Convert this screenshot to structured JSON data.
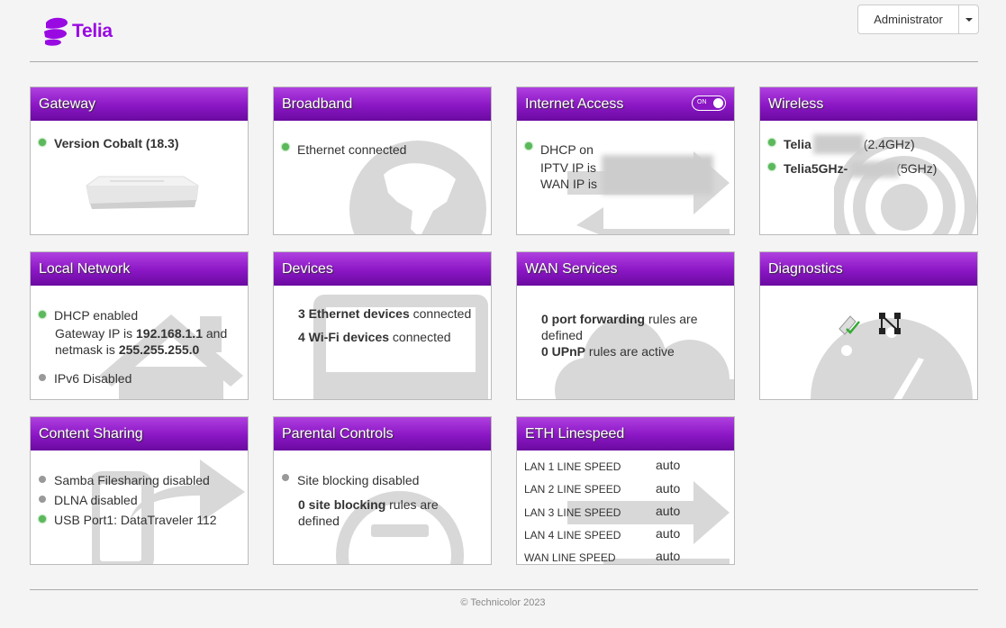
{
  "header": {
    "logo_text": "Telia",
    "user_menu_label": "Administrator"
  },
  "cards": {
    "gateway": {
      "title": "Gateway",
      "version": "Version Cobalt (18.3)"
    },
    "broadband": {
      "title": "Broadband",
      "status": "Ethernet connected"
    },
    "internet": {
      "title": "Internet Access",
      "toggle_label": "ON",
      "dhcp": "DHCP on",
      "iptv": "IPTV IP is",
      "wan": "WAN IP is"
    },
    "wireless": {
      "title": "Wireless",
      "ssid_24": "Telia",
      "band_24": "(2.4GHz)",
      "ssid_5": "Telia5GHz-",
      "band_5": "(5GHz)"
    },
    "local": {
      "title": "Local Network",
      "dhcp": "DHCP enabled",
      "gw_prefix": "Gateway IP is ",
      "gw_ip": "192.168.1.1",
      "gw_and": " and",
      "nm_prefix": "netmask is ",
      "netmask": "255.255.255.0",
      "ipv6": "IPv6 Disabled"
    },
    "devices": {
      "title": "Devices",
      "eth_count": "3 Ethernet devices",
      "eth_suffix": " connected",
      "wifi_count": "4 Wi-Fi devices",
      "wifi_suffix": " connected"
    },
    "wan_services": {
      "title": "WAN Services",
      "pf_count": "0 port forwarding",
      "pf_suffix": " rules are",
      "pf_suffix2": "defined",
      "upnp_count": "0 UPnP",
      "upnp_suffix": " rules are active"
    },
    "diagnostics": {
      "title": "Diagnostics"
    },
    "content": {
      "title": "Content Sharing",
      "samba": "Samba Filesharing disabled",
      "dlna": "DLNA disabled",
      "usb": "USB Port1: DataTraveler 112"
    },
    "parental": {
      "title": "Parental Controls",
      "site": "Site blocking disabled",
      "count": "0 site blocking",
      "suffix": " rules are",
      "suffix2": "defined"
    },
    "eth": {
      "title": "ETH Linespeed",
      "rows": [
        {
          "label": "LAN 1 LINE SPEED",
          "value": "auto"
        },
        {
          "label": "LAN 2 LINE SPEED",
          "value": "auto"
        },
        {
          "label": "LAN 3 LINE SPEED",
          "value": "auto"
        },
        {
          "label": "LAN 4 LINE SPEED",
          "value": "auto"
        },
        {
          "label": "WAN LINE SPEED",
          "value": "auto"
        }
      ]
    }
  },
  "footer": {
    "copyright": "© Technicolor 2023"
  },
  "colors": {
    "brand": "#990ae3",
    "header_purple": "#8a16c4",
    "status_green": "#5bb85b",
    "status_gray": "#999999"
  }
}
